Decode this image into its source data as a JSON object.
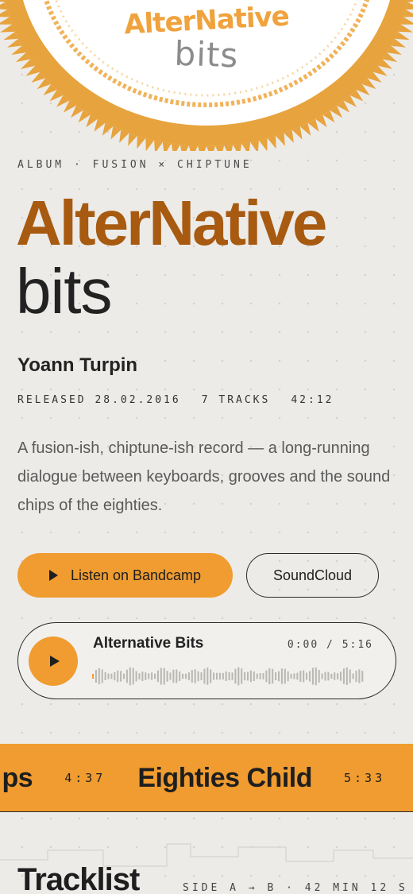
{
  "colors": {
    "accent": "#f09c30",
    "title_brown": "#a75a10",
    "background": "#ecebe8",
    "ink": "#222222"
  },
  "cover": {
    "title_text": "AlterNative",
    "subtitle_text": "bits"
  },
  "hero": {
    "eyebrow": "ALBUM · FUSION × CHIPTUNE",
    "title_line1": "AlterNative",
    "title_line2": "bits",
    "artist": "Yoann Turpin",
    "released": "RELEASED 28.02.2016",
    "tracks": "7 TRACKS",
    "duration": "42:12",
    "description": "A fusion-ish, chiptune-ish record — a long-running dialogue between keyboards, grooves and the sound chips of the eighties."
  },
  "actions": {
    "primary_label": "Listen on Bandcamp",
    "primary_icon": "play-icon",
    "secondary_label": "SoundCloud"
  },
  "player": {
    "track_title": "Alternative Bits",
    "time": "0:00 / 5:16",
    "progress": 0.0,
    "play_icon": "play-icon"
  },
  "marquee": {
    "items": [
      {
        "name": "…ps",
        "time": "4:37"
      },
      {
        "name": "Eighties Child",
        "time": "5:33"
      }
    ]
  },
  "tracklist": {
    "title": "Tracklist",
    "meta": "SIDE A → B · 42 MIN 12 S"
  }
}
